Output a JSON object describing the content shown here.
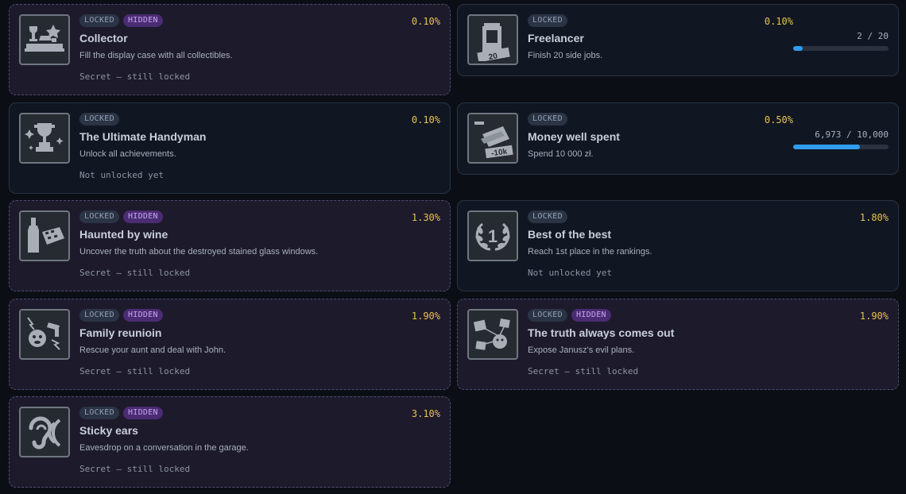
{
  "cards": [
    {
      "title": "Collector",
      "description": "Fill the display case with all collectibles.",
      "percent": "0.10%",
      "status": "Secret — still locked",
      "hidden": true,
      "locked_label": "LOCKED",
      "hidden_label": "HIDDEN",
      "icon": "trophy-collection-icon"
    },
    {
      "title": "Freelancer",
      "description": "Finish 20 side jobs.",
      "percent": "0.10%",
      "hidden": false,
      "locked_label": "LOCKED",
      "icon": "phone-booth-20-icon",
      "progress": {
        "label": "2 / 20",
        "value": 2,
        "max": 20
      }
    },
    {
      "title": "The Ultimate Handyman",
      "description": "Unlock all achievements.",
      "percent": "0.10%",
      "status": "Not unlocked yet",
      "hidden": false,
      "locked_label": "LOCKED",
      "icon": "trophy-sparkle-icon"
    },
    {
      "title": "Money well spent",
      "description": "Spend 10 000 zł.",
      "percent": "0.50%",
      "hidden": false,
      "locked_label": "LOCKED",
      "icon": "money-10k-icon",
      "progress": {
        "label": "6,973 / 10,000",
        "value": 6973,
        "max": 10000
      }
    },
    {
      "title": "Haunted by wine",
      "description": "Uncover the truth about the destroyed stained glass windows.",
      "percent": "1.30%",
      "status": "Secret — still locked",
      "hidden": true,
      "locked_label": "LOCKED",
      "hidden_label": "HIDDEN",
      "icon": "wine-brick-icon"
    },
    {
      "title": "Best of the best",
      "description": "Reach 1st place in the rankings.",
      "percent": "1.80%",
      "status": "Not unlocked yet",
      "hidden": false,
      "locked_label": "LOCKED",
      "icon": "laurel-first-place-icon"
    },
    {
      "title": "Family reunioin",
      "description": "Rescue your aunt and deal with John.",
      "percent": "1.90%",
      "status": "Secret — still locked",
      "hidden": true,
      "locked_label": "LOCKED",
      "hidden_label": "HIDDEN",
      "icon": "family-fight-icon"
    },
    {
      "title": "The truth always comes out",
      "description": "Expose Janusz's evil plans.",
      "percent": "1.90%",
      "status": "Secret — still locked",
      "hidden": true,
      "locked_label": "LOCKED",
      "hidden_label": "HIDDEN",
      "icon": "evidence-board-icon"
    },
    {
      "title": "Sticky ears",
      "description": "Eavesdrop on a conversation in the garage.",
      "percent": "3.10%",
      "status": "Secret — still locked",
      "hidden": true,
      "locked_label": "LOCKED",
      "hidden_label": "HIDDEN",
      "icon": "ear-sound-icon"
    }
  ],
  "colors": {
    "accent": "#2f9cf0",
    "percent": "#e7c24f",
    "hidden_badge": "#4a2c72"
  }
}
